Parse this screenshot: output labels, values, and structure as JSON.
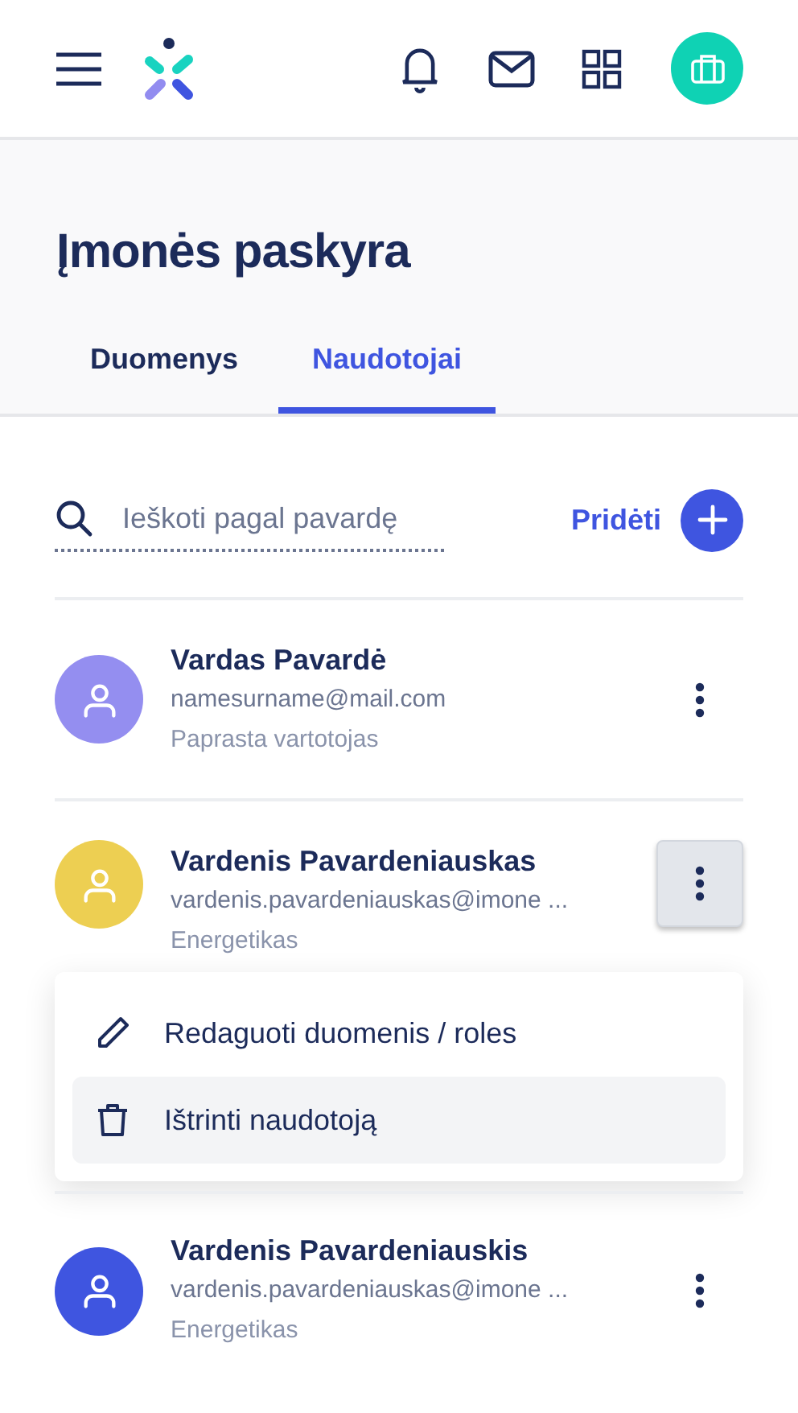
{
  "page": {
    "title": "Įmonės paskyra"
  },
  "tabs": [
    {
      "label": "Duomenys",
      "selected": false
    },
    {
      "label": "Naudotojai",
      "selected": true
    }
  ],
  "search": {
    "placeholder": "Ieškoti pagal pavardę"
  },
  "add_button": {
    "label": "Pridėti"
  },
  "users": [
    {
      "name": "Vardas Pavardė",
      "email": "namesurname@mail.com",
      "role": "Paprasta vartotojas",
      "color": "#948ef0",
      "menu_open": false
    },
    {
      "name": "Vardenis Pavardeniauskas",
      "email": "vardenis.pavardeniauskas@imone ...",
      "role": "Energetikas",
      "color": "#edcf52",
      "menu_open": true
    },
    {
      "name": "Vardenis Pavardeniauskis",
      "email": "vardenis.pavardeniauskas@imone ...",
      "role": "Energetikas",
      "color": "#3f55e0",
      "menu_open": false
    }
  ],
  "menu": [
    {
      "kind": "edit",
      "label": "Redaguoti duomenis / roles",
      "highlighted": false
    },
    {
      "kind": "delete",
      "label": "Ištrinti naudotoją",
      "highlighted": true
    }
  ]
}
